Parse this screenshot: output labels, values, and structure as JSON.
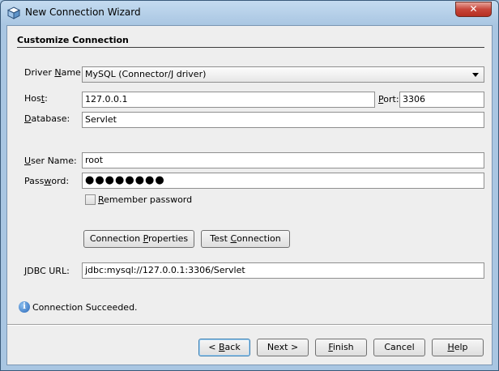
{
  "window": {
    "title": "New Connection Wizard",
    "close_label": "✕"
  },
  "panel": {
    "header": "Customize Connection"
  },
  "form": {
    "driver_name": {
      "label_pre": "Driver ",
      "label_mnemonic": "N",
      "label_post": "ame:",
      "value": "MySQL (Connector/J driver)"
    },
    "host": {
      "label_pre": "Hos",
      "label_mnemonic": "t",
      "label_post": ":",
      "value": "127.0.0.1"
    },
    "port": {
      "label_pre": "",
      "label_mnemonic": "P",
      "label_post": "ort:",
      "value": "3306"
    },
    "database": {
      "label_pre": "",
      "label_mnemonic": "D",
      "label_post": "atabase:",
      "value": "Servlet"
    },
    "user_name": {
      "label_pre": "",
      "label_mnemonic": "U",
      "label_post": "ser Name:",
      "value": "root"
    },
    "password": {
      "label_pre": "Pass",
      "label_mnemonic": "w",
      "label_post": "ord:",
      "value": "●●●●●●●●"
    },
    "remember_password": {
      "label_pre": "",
      "label_mnemonic": "R",
      "label_post": "emember password",
      "checked": false
    },
    "jdbc_url": {
      "label_pre": "",
      "label_mnemonic": "J",
      "label_post": "DBC URL:",
      "value": "jdbc:mysql://127.0.0.1:3306/Servlet"
    }
  },
  "actions": {
    "connection_properties": {
      "pre": "Connection ",
      "mnemonic": "P",
      "post": "roperties"
    },
    "test_connection": {
      "pre": "Test ",
      "mnemonic": "C",
      "post": "onnection"
    }
  },
  "status": {
    "icon": "info-icon",
    "text": "Connection Succeeded."
  },
  "buttons": {
    "back": {
      "pre": "< ",
      "mnemonic": "B",
      "post": "ack"
    },
    "next": {
      "pre": "Next >",
      "mnemonic": "",
      "post": ""
    },
    "finish": {
      "pre": "",
      "mnemonic": "F",
      "post": "inish"
    },
    "cancel": {
      "pre": "Cancel",
      "mnemonic": "",
      "post": ""
    },
    "help": {
      "pre": "",
      "mnemonic": "H",
      "post": "elp"
    }
  }
}
